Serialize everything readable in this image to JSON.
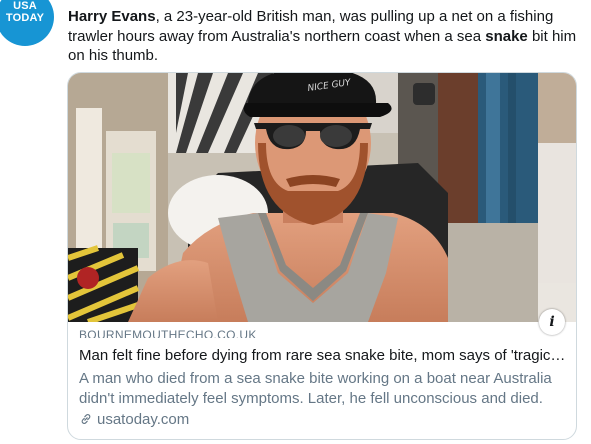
{
  "avatar": {
    "line1": "USA",
    "line2": "TODAY"
  },
  "tweet": {
    "name": "Harry Evans",
    "text1": ", a 23-year-old British man, was pulling up a net on a fishing trawler hours away from Australia's northern coast when a sea ",
    "keyword": "snake",
    "text2": " bit him on his thumb."
  },
  "card": {
    "image_cap_text": "NICE GUY",
    "info_label": "i",
    "domain": "BOURNEMOUTHECHO.CO.UK",
    "title": "Man felt fine before dying from rare sea snake bite, mom says of 'tragic accident'",
    "description": "A man who died from a sea snake bite working on a boat near Australia didn't immediately feel symptoms. Later, he fell unconscious and died.",
    "link": "usatoday.com"
  },
  "colors": {
    "brand": "#1795d4",
    "text": "#14171a",
    "muted": "#657786",
    "border": "#cfd9de"
  }
}
